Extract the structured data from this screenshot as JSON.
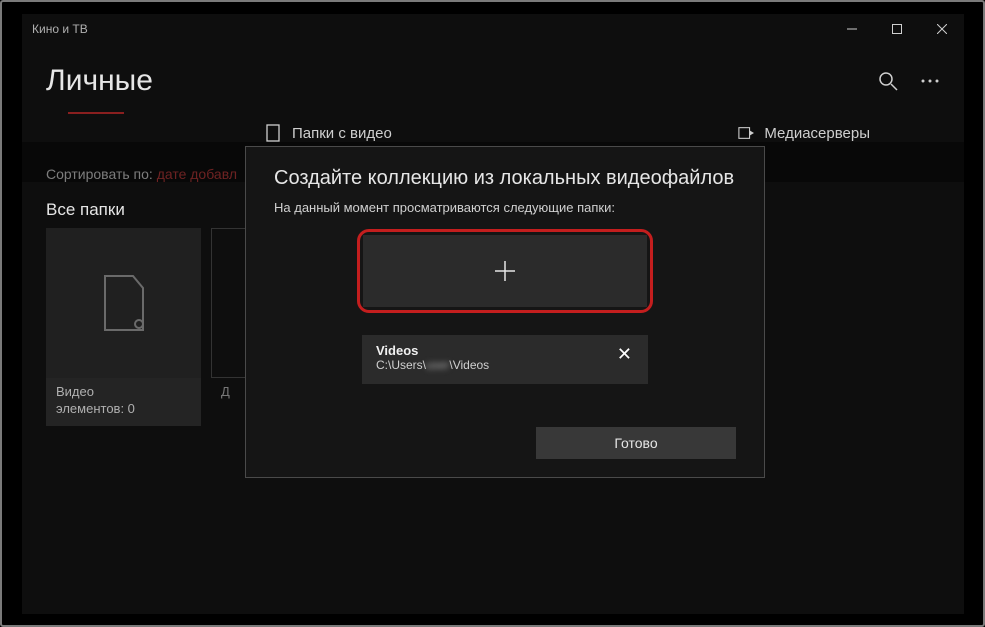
{
  "app": {
    "title": "Кино и ТВ"
  },
  "page": {
    "title": "Личные"
  },
  "tabs": {
    "videos": "Папки с видео",
    "media_servers": "Медиасерверы"
  },
  "sort": {
    "label": "Сортировать по: ",
    "value": "дате добавл"
  },
  "section": {
    "all_folders": "Все папки"
  },
  "card": {
    "title": "Видео",
    "count_line": "элементов: 0",
    "second_card_text": "Д"
  },
  "dialog": {
    "title": "Создайте коллекцию из локальных видеофайлов",
    "subtitle": "На данный момент просматриваются следующие папки:",
    "folder": {
      "name": "Videos",
      "path_prefix": "C:\\Users\\",
      "path_user": "user",
      "path_suffix": "\\Videos"
    },
    "done": "Готово"
  },
  "icons": {
    "plus": "+",
    "close": "✕"
  }
}
